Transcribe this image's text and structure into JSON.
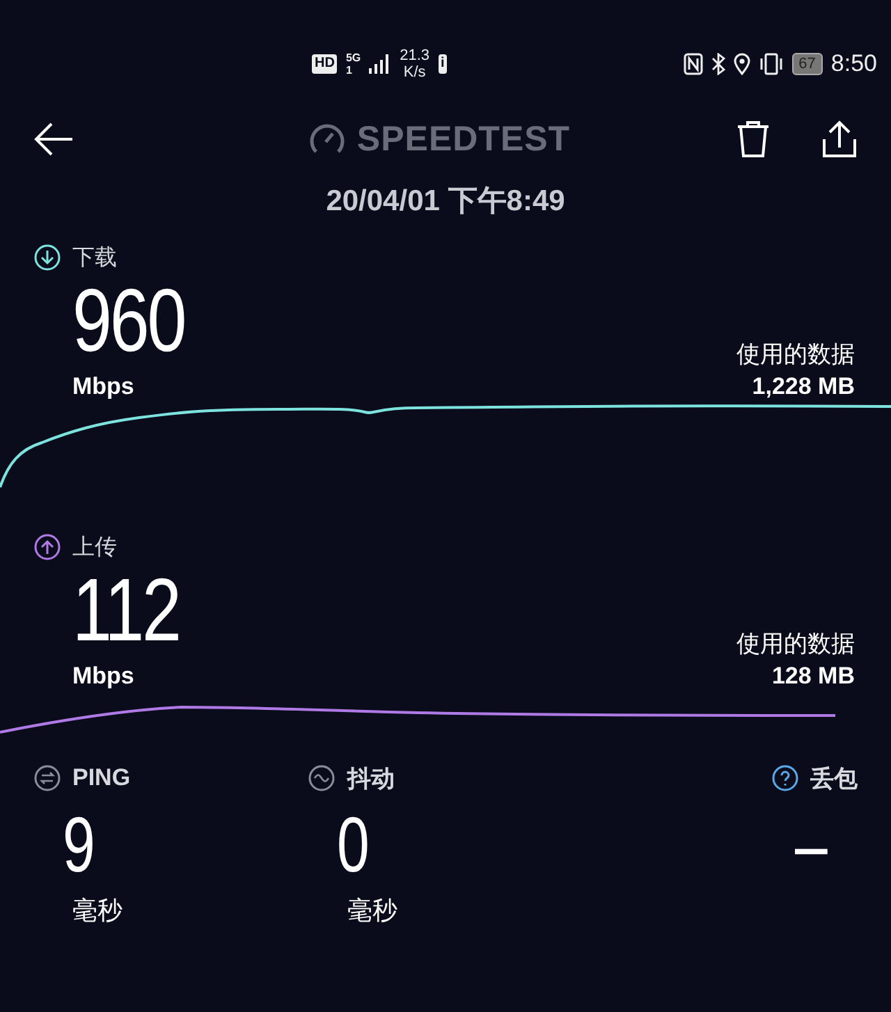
{
  "status_bar": {
    "hd_badge": "HD",
    "network": "5G",
    "sim": "1",
    "speed_value": "21.3",
    "speed_unit": "K/s",
    "info_badge": "i",
    "battery": "67",
    "time": "8:50"
  },
  "header": {
    "title": "SPEEDTEST",
    "date": "20/04/01 下午8:49"
  },
  "results": [
    {
      "kind": "download",
      "label": "下载",
      "value": "960",
      "unit": "Mbps",
      "data_label": "使用的数据",
      "data_value": "1,228 MB",
      "color": "#7de3df"
    },
    {
      "kind": "upload",
      "label": "上传",
      "value": "112",
      "unit": "Mbps",
      "data_label": "使用的数据",
      "data_value": "128 MB",
      "color": "#b07ae6"
    }
  ],
  "metrics": [
    {
      "kind": "ping",
      "label": "PING",
      "value": "9",
      "unit": "毫秒"
    },
    {
      "kind": "jitter",
      "label": "抖动",
      "value": "0",
      "unit": "毫秒"
    },
    {
      "kind": "loss",
      "label": "丢包",
      "value": "–"
    }
  ]
}
